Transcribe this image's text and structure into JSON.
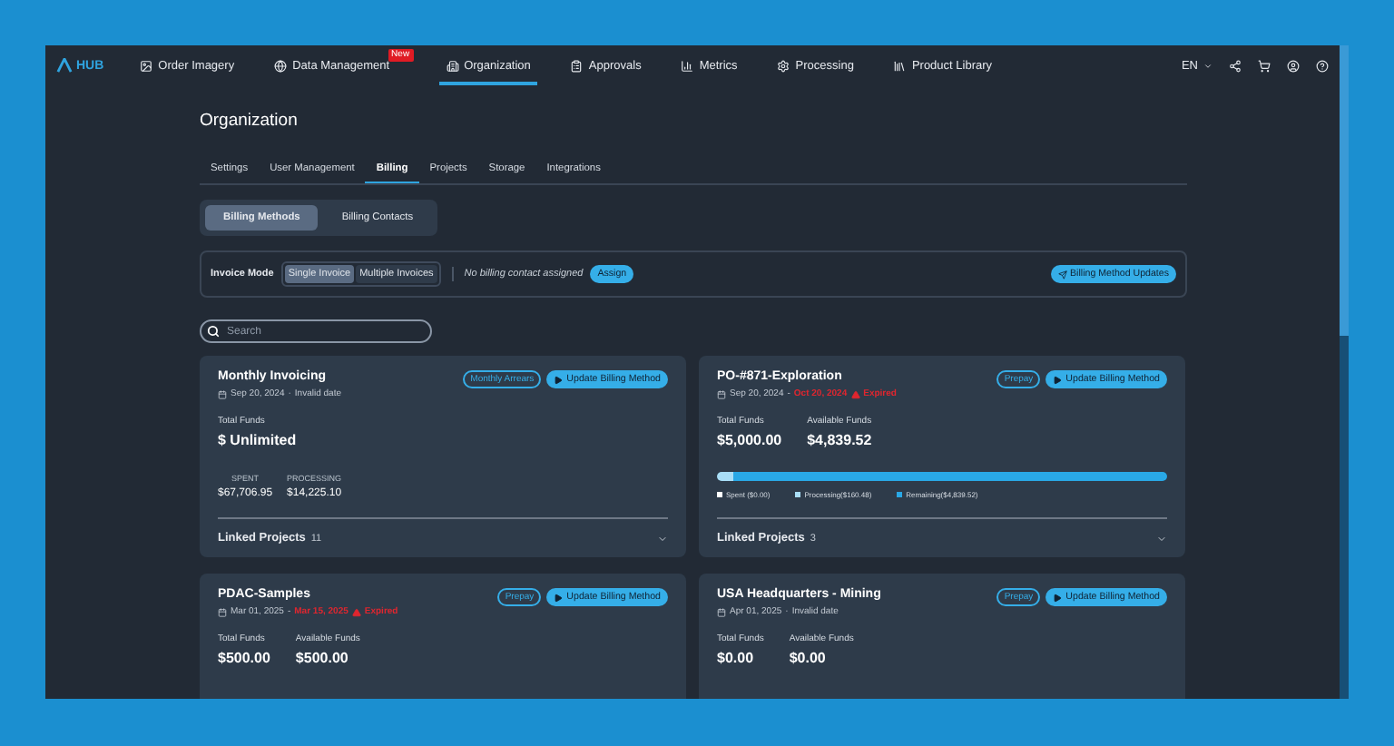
{
  "nav": {
    "logo": "HUB",
    "items": [
      {
        "label": "Order Imagery",
        "selected": false
      },
      {
        "label": "Data Management",
        "selected": false,
        "badge": "New"
      },
      {
        "label": "Organization",
        "selected": true
      },
      {
        "label": "Approvals",
        "selected": false
      },
      {
        "label": "Metrics",
        "selected": false
      },
      {
        "label": "Processing",
        "selected": false
      },
      {
        "label": "Product Library",
        "selected": false
      }
    ],
    "language": "EN"
  },
  "page_title": "Organization",
  "tabs": [
    {
      "label": "Settings",
      "selected": false
    },
    {
      "label": "User Management",
      "selected": false
    },
    {
      "label": "Billing",
      "selected": true
    },
    {
      "label": "Projects",
      "selected": false
    },
    {
      "label": "Storage",
      "selected": false
    },
    {
      "label": "Integrations",
      "selected": false
    }
  ],
  "subtabs": [
    {
      "label": "Billing Methods",
      "selected": true
    },
    {
      "label": "Billing Contacts",
      "selected": false
    }
  ],
  "invoice": {
    "label": "Invoice Mode",
    "options": [
      {
        "label": "Single Invoice",
        "selected": true
      },
      {
        "label": "Multiple Invoices",
        "selected": false
      }
    ],
    "contact_note": "No billing contact assigned",
    "assign": "Assign",
    "updates_button": "Billing Method Updates"
  },
  "search": {
    "placeholder": "Search"
  },
  "cards": [
    {
      "title": "Monthly Invoicing",
      "tag": "Monthly Arrears",
      "action": "Update Billing Method",
      "start": "Sep 20, 2024",
      "separator": "·",
      "end": "Invalid date",
      "expired": false,
      "funds": [
        {
          "label": "Total Funds",
          "value": "$ Unlimited"
        }
      ],
      "stats": [
        {
          "label": "SPENT",
          "value": "$67,706.95"
        },
        {
          "label": "PROCESSING",
          "value": "$14,225.10"
        }
      ],
      "linked": {
        "label": "Linked Projects",
        "count": "11"
      }
    },
    {
      "title": "PO-#871-Exploration",
      "tag": "Prepay",
      "action": "Update Billing Method",
      "start": "Sep 20, 2024",
      "separator": "-",
      "end": "Oct 20, 2024",
      "expired": true,
      "status": "Expired",
      "funds": [
        {
          "label": "Total Funds",
          "value": "$5,000.00"
        },
        {
          "label": "Available Funds",
          "value": "$4,839.52"
        }
      ],
      "segments": [
        {
          "label": "Spent ($0.00)",
          "color": "#ffffff"
        },
        {
          "label": "Processing($160.48)",
          "level": 0.035,
          "color": "#a9def7"
        },
        {
          "label": "Remaining($4,839.52)",
          "level": 0.965,
          "color": "#29a8e6"
        }
      ],
      "linked": {
        "label": "Linked Projects",
        "count": "3"
      }
    },
    {
      "title": "PDAC-Samples",
      "tag": "Prepay",
      "action": "Update Billing Method",
      "start": "Mar 01, 2025",
      "separator": "-",
      "end": "Mar 15, 2025",
      "expired": true,
      "status": "Expired",
      "funds": [
        {
          "label": "Total Funds",
          "value": "$500.00"
        },
        {
          "label": "Available Funds",
          "value": "$500.00"
        }
      ]
    },
    {
      "title": "USA Headquarters - Mining",
      "tag": "Prepay",
      "action": "Update Billing Method",
      "start": "Apr 01, 2025",
      "separator": "·",
      "end": "Invalid date",
      "expired": false,
      "funds": [
        {
          "label": "Total Funds",
          "value": "$0.00"
        },
        {
          "label": "Available Funds",
          "value": "$0.00"
        }
      ]
    }
  ]
}
